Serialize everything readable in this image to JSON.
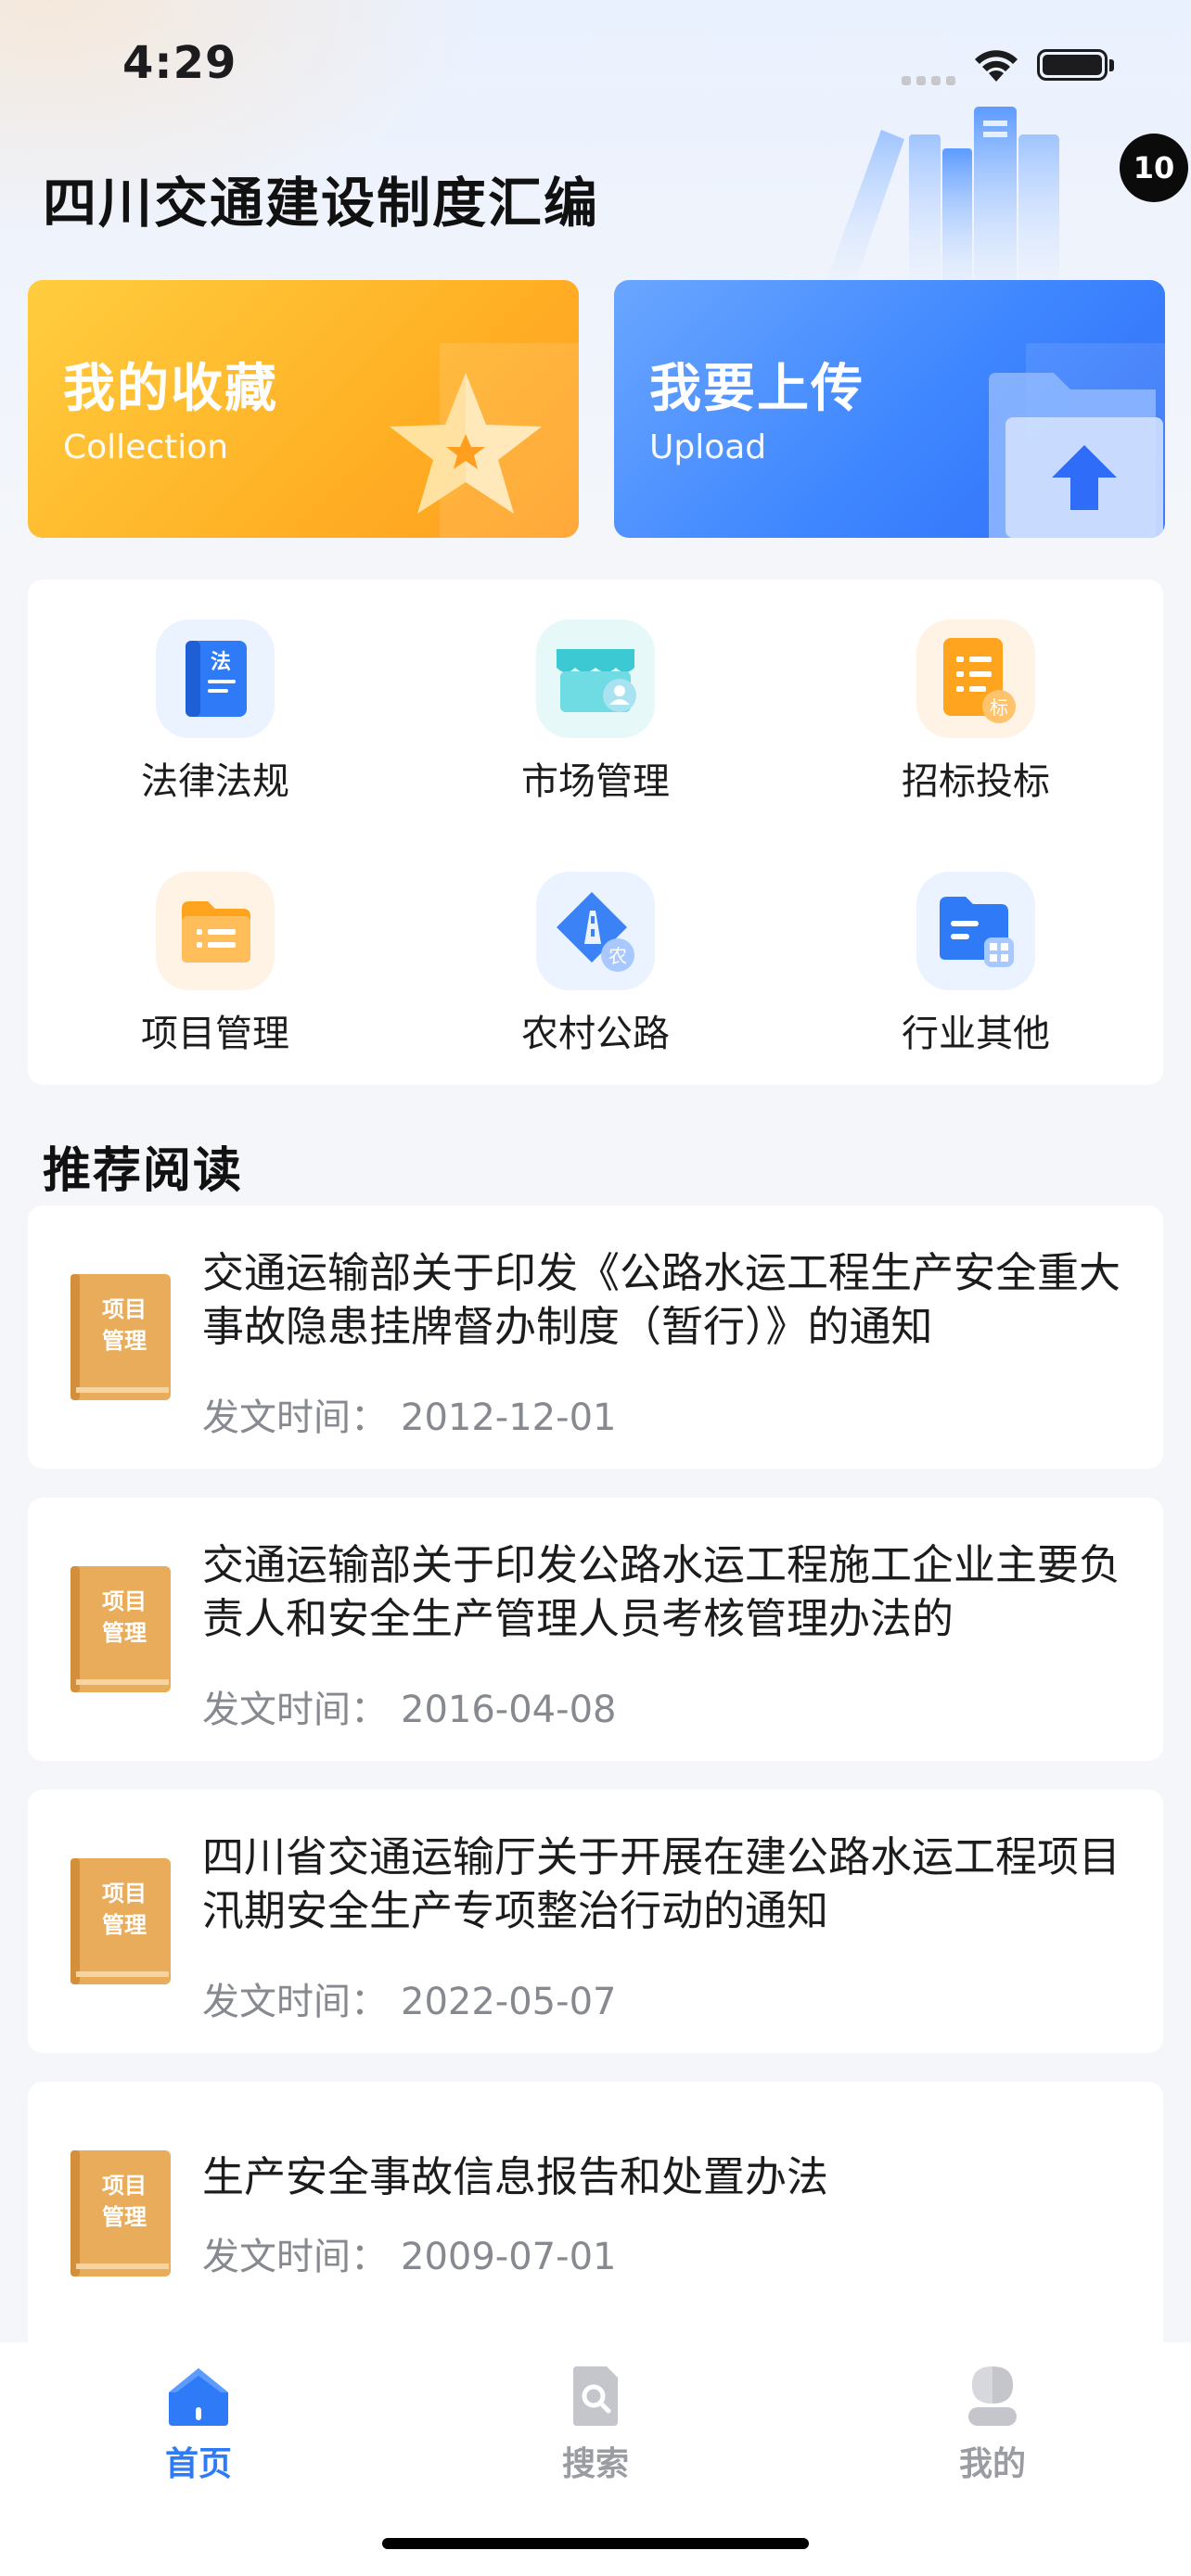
{
  "status": {
    "time": "4:29"
  },
  "badge": {
    "count": "10"
  },
  "app": {
    "title": "四川交通建设制度汇编"
  },
  "cards": {
    "collection": {
      "title": "我的收藏",
      "subtitle": "Collection"
    },
    "upload": {
      "title": "我要上传",
      "subtitle": "Upload"
    }
  },
  "categories": [
    {
      "label": "法律法规",
      "icon": "law-book-icon",
      "glyph": "法"
    },
    {
      "label": "市场管理",
      "icon": "market-store-icon"
    },
    {
      "label": "招标投标",
      "icon": "bidding-doc-icon",
      "glyph": "标"
    },
    {
      "label": "项目管理",
      "icon": "project-folder-icon"
    },
    {
      "label": "农村公路",
      "icon": "rural-road-icon",
      "glyph": "农"
    },
    {
      "label": "行业其他",
      "icon": "industry-other-icon"
    }
  ],
  "recommend": {
    "title": "推荐阅读",
    "date_label": "发文时间：",
    "book_label_line1": "项目",
    "book_label_line2": "管理",
    "articles": [
      {
        "title": "交通运输部关于印发《公路水运工程生产安全重大事故隐患挂牌督办制度（暂行）》的通知",
        "date": "2012-12-01"
      },
      {
        "title": "交通运输部关于印发公路水运工程施工企业主要负责人和安全生产管理人员考核管理办法的",
        "date": "2016-04-08"
      },
      {
        "title": "四川省交通运输厅关于开展在建公路水运工程项目汛期安全生产专项整治行动的通知",
        "date": "2022-05-07"
      },
      {
        "title": "生产安全事故信息报告和处置办法",
        "date": "2009-07-01"
      }
    ]
  },
  "tabbar": {
    "home": "首页",
    "search": "搜索",
    "mine": "我的",
    "active_color": "#2f7bf7",
    "inactive_color": "#9a9ca2"
  }
}
